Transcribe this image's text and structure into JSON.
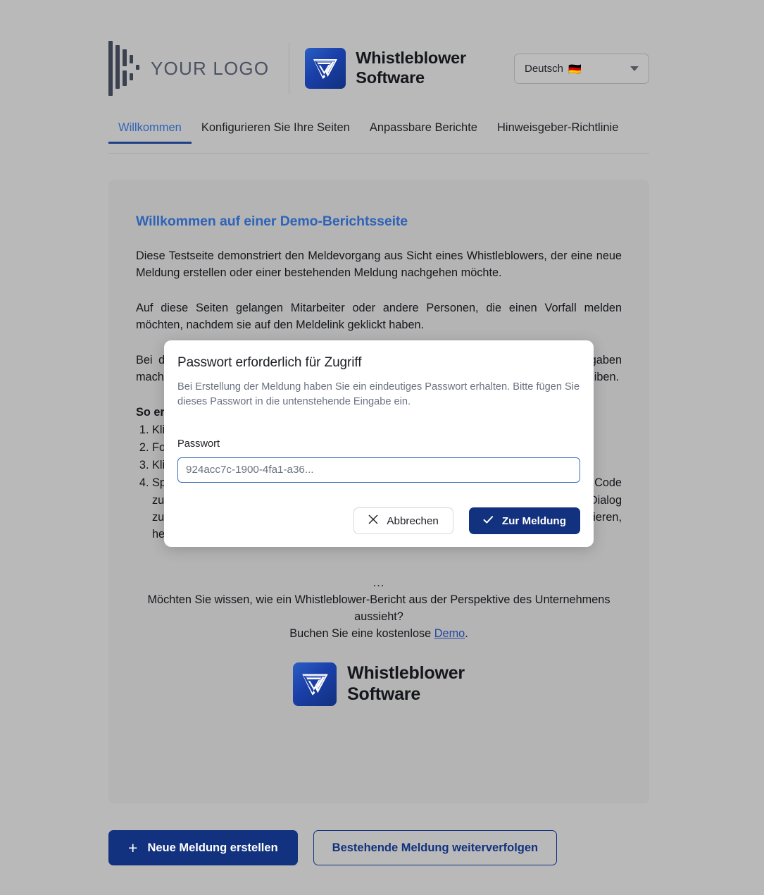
{
  "header": {
    "your_logo_text": "YOUR LOGO",
    "brand_line1": "Whistleblower",
    "brand_line2": "Software",
    "language": {
      "label": "Deutsch",
      "flag": "🇩🇪",
      "icon": "chevron-down-icon"
    }
  },
  "tabs": [
    {
      "label": "Willkommen",
      "active": true
    },
    {
      "label": "Konfigurieren Sie Ihre Seiten",
      "active": false
    },
    {
      "label": "Anpassbare Berichte",
      "active": false
    },
    {
      "label": "Hinweisgeber-Richtlinie",
      "active": false
    }
  ],
  "content": {
    "heading": "Willkommen auf einer Demo-Berichtsseite",
    "paragraph1": "Diese Testseite demonstriert den Meldevorgang aus Sicht eines Whistleblowers, der eine neue Meldung erstellen oder einer bestehenden Meldung nachgehen möchte.",
    "paragraph2": "Auf diese Seiten gelangen Mitarbeiter oder andere Personen, die einen Vorfall melden möchten, nachdem sie auf den Meldelink geklickt haben.",
    "paragraph3": "Bei der Erstellung einer Meldung wird die Berichtsseite erstellt. Hier können Sie Angaben machen, um beispielsweise einen Vorfall zu schildern. Dabei können Sie ganz anonym bleiben.",
    "steps_title": "So erstellen Sie eine Meldung:",
    "steps": [
      "Klicken Sie auf \"Neue Meldung erstellen\".",
      "Folgen Sie den Anweisungen im Formular.",
      "Klicken Sie auf \"Meldung absenden\".",
      "Speichern Sie den angezeigten Zugangscode. Der Bericht ist nur über diesen Code zugänglich. Mit seiner Meldung kann der Hinweisgeber mit der Organisation in den Dialog zu treten und den Status der Meldung einzusehen. Sie können den Code kopieren, herunterladen oder an ihre E-Mail-Adresse senden lassen."
    ],
    "outro_dots": "...",
    "outro_line1": "Möchten Sie wissen, wie ein Whistleblower-Bericht aus der Perspektive des Unternehmens aussieht?",
    "outro_line2_pre": "Buchen Sie eine kostenlose ",
    "outro_link": "Demo",
    "outro_line2_post": ".",
    "brand_line1": "Whistleblower",
    "brand_line2": "Software"
  },
  "footer": {
    "new_report_label": "Neue Meldung erstellen",
    "new_report_icon": "plus-icon",
    "follow_report_label": "Bestehende Meldung weiterverfolgen"
  },
  "modal": {
    "title": "Passwort erforderlich für Zugriff",
    "description": "Bei Erstellung der Meldung haben Sie ein eindeutiges Passwort erhalten. Bitte fügen Sie dieses Passwort in die untenstehende Eingabe ein.",
    "field_label": "Passwort",
    "password_placeholder": "924acc7c-1900-4fa1-a36...",
    "password_value": "",
    "cancel_label": "Abbrechen",
    "cancel_icon": "close-icon",
    "confirm_label": "Zur Meldung",
    "confirm_icon": "check-icon"
  },
  "colors": {
    "brand_blue": "#12317e",
    "accent_blue": "#2f63b8",
    "page_bg": "#b9b9b9",
    "card_bg": "#b4b4b4",
    "modal_bg": "#ffffff"
  }
}
